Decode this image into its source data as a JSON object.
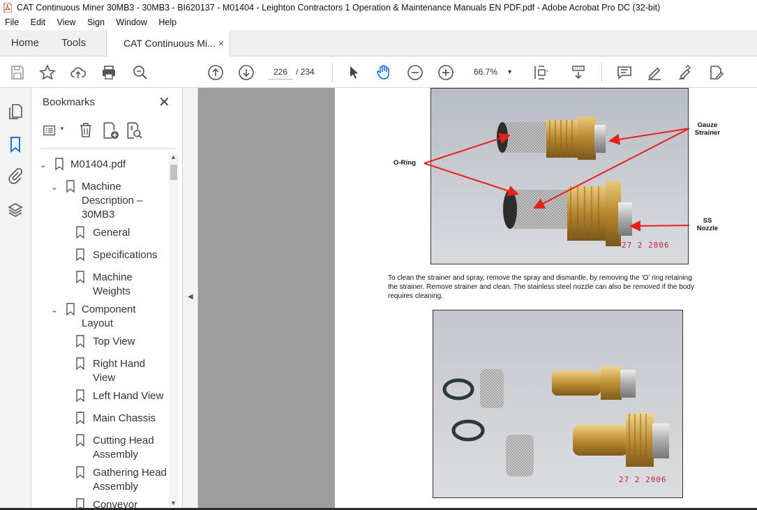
{
  "window": {
    "title": "CAT Continuous Miner 30MB3 - 30MB3 - BI620137 - M01404 - Leighton Contractors 1 Operation & Maintenance Manuals EN PDF.pdf - Adobe Acrobat Pro DC (32-bit)"
  },
  "menu": [
    "File",
    "Edit",
    "View",
    "Sign",
    "Window",
    "Help"
  ],
  "tabs": {
    "home": "Home",
    "tools": "Tools",
    "document": "CAT Continuous Mi...",
    "close": "×"
  },
  "toolbar": {
    "page_current": "226",
    "page_total": "/  234",
    "zoom": "66.7%"
  },
  "bookmarks": {
    "header": "Bookmarks",
    "close": "✕",
    "items": [
      {
        "label": "M01404.pdf"
      },
      {
        "label": "Machine Description – 30MB3"
      },
      {
        "label": "General"
      },
      {
        "label": "Specifications"
      },
      {
        "label": "Machine Weights"
      },
      {
        "label": "Component Layout"
      },
      {
        "label": "Top View"
      },
      {
        "label": "Right Hand View"
      },
      {
        "label": "Left Hand View"
      },
      {
        "label": "Main Chassis"
      },
      {
        "label": "Cutting Head Assembly"
      },
      {
        "label": "Gathering Head Assembly"
      },
      {
        "label": "Conveyor"
      }
    ]
  },
  "document": {
    "photo1": {
      "label_gauze": "Gauze Strainer",
      "label_oring": "O-Ring",
      "label_ss": "SS Nozzle",
      "date": "27  2 2006"
    },
    "paragraph": "To clean the strainer and spray, remove the spray and dismantle, by removing the ‘O’ ring retaining the strainer. Remove strainer and clean. The stainless steel nozzle can also be removed if the body requires cleaning.",
    "photo2": {
      "date": "27  2 2006"
    }
  },
  "colors": {
    "accent": "#1473e6",
    "annotation_red": "#e8201a",
    "doc_bg": "#9d9d9d"
  }
}
